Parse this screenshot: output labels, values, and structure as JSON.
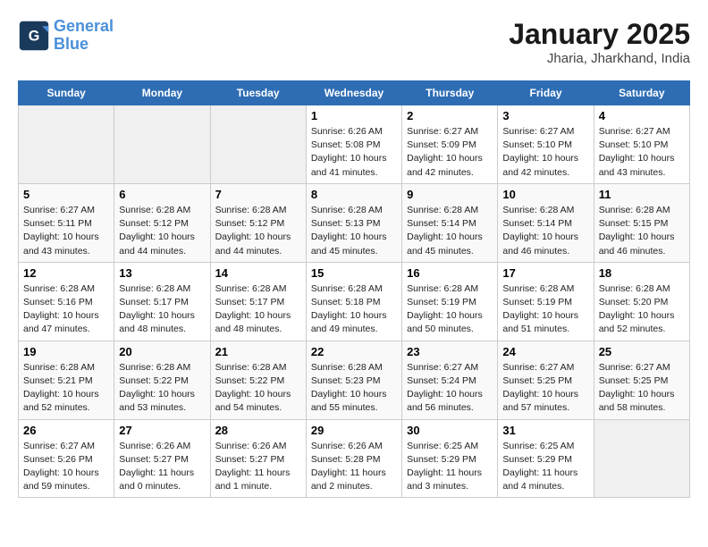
{
  "header": {
    "logo_line1": "General",
    "logo_line2": "Blue",
    "title": "January 2025",
    "subtitle": "Jharia, Jharkhand, India"
  },
  "weekdays": [
    "Sunday",
    "Monday",
    "Tuesday",
    "Wednesday",
    "Thursday",
    "Friday",
    "Saturday"
  ],
  "weeks": [
    [
      {
        "day": "",
        "info": ""
      },
      {
        "day": "",
        "info": ""
      },
      {
        "day": "",
        "info": ""
      },
      {
        "day": "1",
        "info": "Sunrise: 6:26 AM\nSunset: 5:08 PM\nDaylight: 10 hours\nand 41 minutes."
      },
      {
        "day": "2",
        "info": "Sunrise: 6:27 AM\nSunset: 5:09 PM\nDaylight: 10 hours\nand 42 minutes."
      },
      {
        "day": "3",
        "info": "Sunrise: 6:27 AM\nSunset: 5:10 PM\nDaylight: 10 hours\nand 42 minutes."
      },
      {
        "day": "4",
        "info": "Sunrise: 6:27 AM\nSunset: 5:10 PM\nDaylight: 10 hours\nand 43 minutes."
      }
    ],
    [
      {
        "day": "5",
        "info": "Sunrise: 6:27 AM\nSunset: 5:11 PM\nDaylight: 10 hours\nand 43 minutes."
      },
      {
        "day": "6",
        "info": "Sunrise: 6:28 AM\nSunset: 5:12 PM\nDaylight: 10 hours\nand 44 minutes."
      },
      {
        "day": "7",
        "info": "Sunrise: 6:28 AM\nSunset: 5:12 PM\nDaylight: 10 hours\nand 44 minutes."
      },
      {
        "day": "8",
        "info": "Sunrise: 6:28 AM\nSunset: 5:13 PM\nDaylight: 10 hours\nand 45 minutes."
      },
      {
        "day": "9",
        "info": "Sunrise: 6:28 AM\nSunset: 5:14 PM\nDaylight: 10 hours\nand 45 minutes."
      },
      {
        "day": "10",
        "info": "Sunrise: 6:28 AM\nSunset: 5:14 PM\nDaylight: 10 hours\nand 46 minutes."
      },
      {
        "day": "11",
        "info": "Sunrise: 6:28 AM\nSunset: 5:15 PM\nDaylight: 10 hours\nand 46 minutes."
      }
    ],
    [
      {
        "day": "12",
        "info": "Sunrise: 6:28 AM\nSunset: 5:16 PM\nDaylight: 10 hours\nand 47 minutes."
      },
      {
        "day": "13",
        "info": "Sunrise: 6:28 AM\nSunset: 5:17 PM\nDaylight: 10 hours\nand 48 minutes."
      },
      {
        "day": "14",
        "info": "Sunrise: 6:28 AM\nSunset: 5:17 PM\nDaylight: 10 hours\nand 48 minutes."
      },
      {
        "day": "15",
        "info": "Sunrise: 6:28 AM\nSunset: 5:18 PM\nDaylight: 10 hours\nand 49 minutes."
      },
      {
        "day": "16",
        "info": "Sunrise: 6:28 AM\nSunset: 5:19 PM\nDaylight: 10 hours\nand 50 minutes."
      },
      {
        "day": "17",
        "info": "Sunrise: 6:28 AM\nSunset: 5:19 PM\nDaylight: 10 hours\nand 51 minutes."
      },
      {
        "day": "18",
        "info": "Sunrise: 6:28 AM\nSunset: 5:20 PM\nDaylight: 10 hours\nand 52 minutes."
      }
    ],
    [
      {
        "day": "19",
        "info": "Sunrise: 6:28 AM\nSunset: 5:21 PM\nDaylight: 10 hours\nand 52 minutes."
      },
      {
        "day": "20",
        "info": "Sunrise: 6:28 AM\nSunset: 5:22 PM\nDaylight: 10 hours\nand 53 minutes."
      },
      {
        "day": "21",
        "info": "Sunrise: 6:28 AM\nSunset: 5:22 PM\nDaylight: 10 hours\nand 54 minutes."
      },
      {
        "day": "22",
        "info": "Sunrise: 6:28 AM\nSunset: 5:23 PM\nDaylight: 10 hours\nand 55 minutes."
      },
      {
        "day": "23",
        "info": "Sunrise: 6:27 AM\nSunset: 5:24 PM\nDaylight: 10 hours\nand 56 minutes."
      },
      {
        "day": "24",
        "info": "Sunrise: 6:27 AM\nSunset: 5:25 PM\nDaylight: 10 hours\nand 57 minutes."
      },
      {
        "day": "25",
        "info": "Sunrise: 6:27 AM\nSunset: 5:25 PM\nDaylight: 10 hours\nand 58 minutes."
      }
    ],
    [
      {
        "day": "26",
        "info": "Sunrise: 6:27 AM\nSunset: 5:26 PM\nDaylight: 10 hours\nand 59 minutes."
      },
      {
        "day": "27",
        "info": "Sunrise: 6:26 AM\nSunset: 5:27 PM\nDaylight: 11 hours\nand 0 minutes."
      },
      {
        "day": "28",
        "info": "Sunrise: 6:26 AM\nSunset: 5:27 PM\nDaylight: 11 hours\nand 1 minute."
      },
      {
        "day": "29",
        "info": "Sunrise: 6:26 AM\nSunset: 5:28 PM\nDaylight: 11 hours\nand 2 minutes."
      },
      {
        "day": "30",
        "info": "Sunrise: 6:25 AM\nSunset: 5:29 PM\nDaylight: 11 hours\nand 3 minutes."
      },
      {
        "day": "31",
        "info": "Sunrise: 6:25 AM\nSunset: 5:29 PM\nDaylight: 11 hours\nand 4 minutes."
      },
      {
        "day": "",
        "info": ""
      }
    ]
  ]
}
